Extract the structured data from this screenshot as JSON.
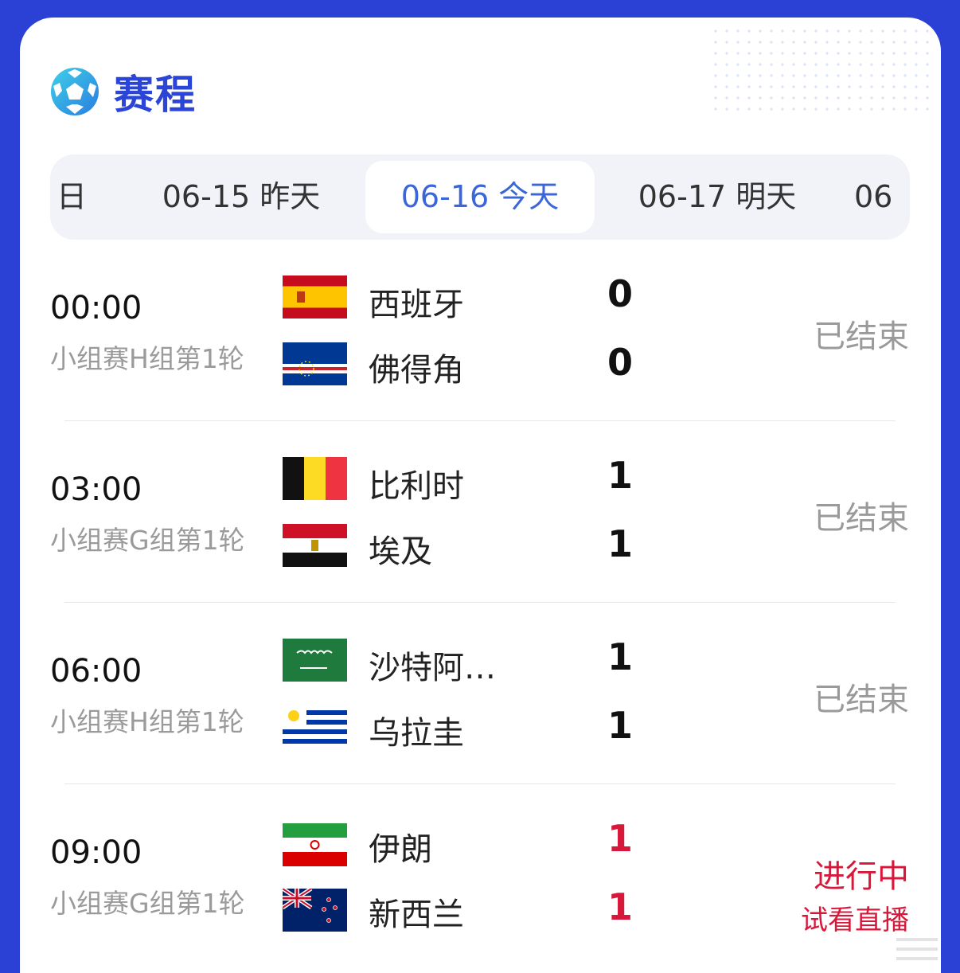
{
  "header": {
    "title": "赛程",
    "icon": "football-icon",
    "accent": "#2a45d8"
  },
  "tabs": [
    {
      "label": "日",
      "active": false
    },
    {
      "label": "06-15 昨天",
      "active": false
    },
    {
      "label": "06-16 今天",
      "active": true
    },
    {
      "label": "06-17 明天",
      "active": false
    },
    {
      "label": "06",
      "active": false
    }
  ],
  "matches": [
    {
      "time": "00:00",
      "stage": "小组赛H组第1轮",
      "home": {
        "name": "西班牙",
        "flag": "spain-flag-icon",
        "score": "0"
      },
      "away": {
        "name": "佛得角",
        "flag": "cape-verde-flag-icon",
        "score": "0"
      },
      "status": "已结束"
    },
    {
      "time": "03:00",
      "stage": "小组赛G组第1轮",
      "home": {
        "name": "比利时",
        "flag": "belgium-flag-icon",
        "score": "1"
      },
      "away": {
        "name": "埃及",
        "flag": "egypt-flag-icon",
        "score": "1"
      },
      "status": "已结束"
    },
    {
      "time": "06:00",
      "stage": "小组赛H组第1轮",
      "home": {
        "name": "沙特阿…",
        "flag": "saudi-arabia-flag-icon",
        "score": "1"
      },
      "away": {
        "name": "乌拉圭",
        "flag": "uruguay-flag-icon",
        "score": "1"
      },
      "status": "已结束"
    },
    {
      "time": "09:00",
      "stage": "小组赛G组第1轮",
      "home": {
        "name": "伊朗",
        "flag": "iran-flag-icon",
        "score": "1"
      },
      "away": {
        "name": "新西兰",
        "flag": "new-zealand-flag-icon",
        "score": "1"
      },
      "status": "进行中",
      "substatus": "试看直播"
    }
  ],
  "colors": {
    "live": "#d8183a",
    "muted": "#9a9a9a",
    "active_tab": "#3a66d9"
  }
}
